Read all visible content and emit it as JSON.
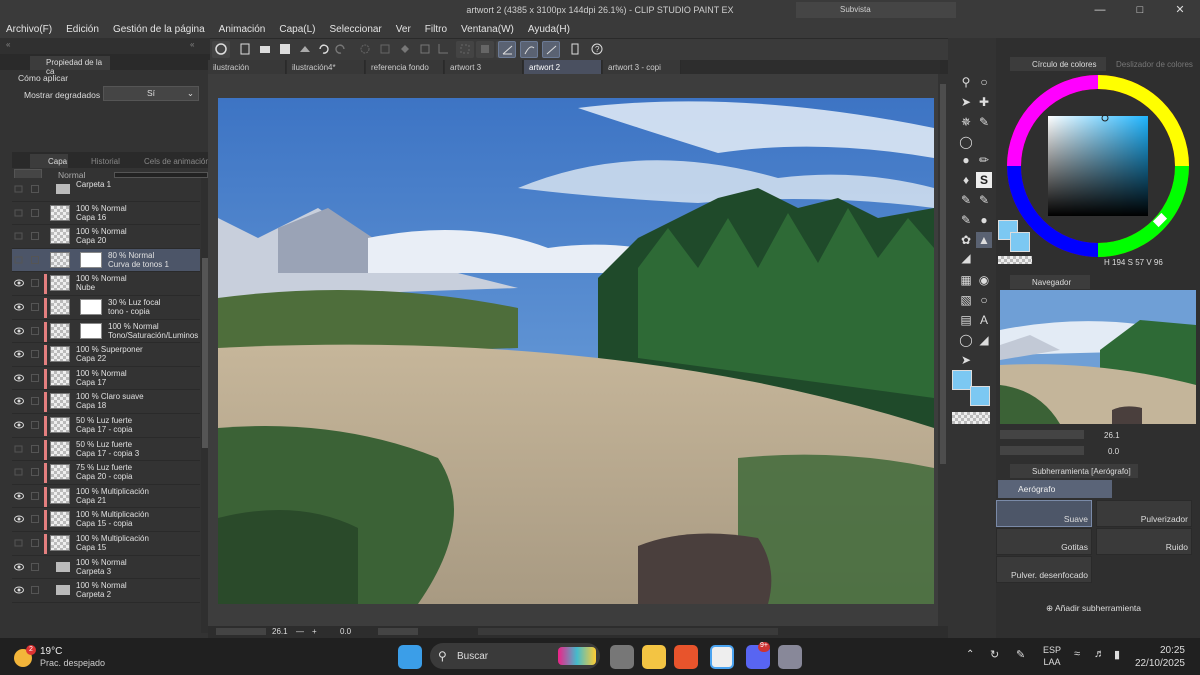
{
  "window": {
    "title": "artwort 2 (4385 x 3100px 144dpi 26.1%)  - CLIP STUDIO PAINT EX",
    "subview_label": "Subvista"
  },
  "menu": [
    "Archivo(F)",
    "Edición",
    "Gestión de la página",
    "Animación",
    "Capa(L)",
    "Seleccionar",
    "Ver",
    "Filtro",
    "Ventana(W)",
    "Ayuda(H)"
  ],
  "left_panel": {
    "property_tab": "Propiedad de la ca",
    "section_title": "Cómo aplicar",
    "gradient_label": "Mostrar degradados",
    "gradient_value": "Sí",
    "tabs": [
      "Capa",
      "Historial",
      "Cels de animación"
    ],
    "blend_mode": "Normal",
    "layers": [
      {
        "l1": "Carpeta 1",
        "l2": "",
        "folder": true,
        "vis": false,
        "sel": false
      },
      {
        "l1": "100 % Normal",
        "l2": "Capa 16",
        "vis": false,
        "sel": false
      },
      {
        "l1": "100 % Normal",
        "l2": "Capa 20",
        "vis": false,
        "sel": false
      },
      {
        "l1": "80 % Normal",
        "l2": "Curva de tonos 1",
        "vis": false,
        "sel": true
      },
      {
        "l1": "100 % Normal",
        "l2": "Nube",
        "vis": true,
        "sel": false
      },
      {
        "l1": "30 % Luz focal",
        "l2": "tono - copia",
        "vis": true,
        "sel": false
      },
      {
        "l1": "100 % Normal",
        "l2": "Tono/Saturación/Luminosida",
        "vis": true,
        "sel": false
      },
      {
        "l1": "100 % Superponer",
        "l2": "Capa 22",
        "vis": true,
        "sel": false
      },
      {
        "l1": "100 % Normal",
        "l2": "Capa 17",
        "vis": true,
        "sel": false
      },
      {
        "l1": "100 % Claro suave",
        "l2": "Capa 18",
        "vis": true,
        "sel": false
      },
      {
        "l1": "50 % Luz fuerte",
        "l2": "Capa 17 - copia",
        "vis": true,
        "sel": false
      },
      {
        "l1": "50 % Luz fuerte",
        "l2": "Capa 17 - copia 3",
        "vis": false,
        "sel": false
      },
      {
        "l1": "75 % Luz fuerte",
        "l2": "Capa 20 - copia",
        "vis": false,
        "sel": false
      },
      {
        "l1": "100 % Multiplicación",
        "l2": "Capa 21",
        "vis": true,
        "sel": false
      },
      {
        "l1": "100 % Multiplicación",
        "l2": "Capa 15 - copia",
        "vis": true,
        "sel": false
      },
      {
        "l1": "100 % Multiplicación",
        "l2": "Capa 15",
        "vis": false,
        "sel": false
      },
      {
        "l1": "100 % Normal",
        "l2": "Carpeta 3",
        "folder": true,
        "vis": true,
        "sel": false
      },
      {
        "l1": "100 % Normal",
        "l2": "Carpeta 2",
        "folder": true,
        "vis": true,
        "sel": false
      }
    ]
  },
  "doc_tabs": [
    "ilustración",
    "ilustración4*",
    "referencia fondo",
    "artwort 3",
    "artwort 2",
    "artwort 3 - copi"
  ],
  "canvas_bar": {
    "zoom": "26.1",
    "angle": "0.0"
  },
  "right_panel": {
    "color_tabs": [
      "Círculo de colores",
      "Deslizador de colores"
    ],
    "hsv": {
      "h": "194",
      "s": "57",
      "v": "96"
    },
    "navigator_label": "Navegador",
    "nav_zoom": "26.1",
    "nav_angle": "0.0",
    "subtool_tab": "Subherramienta [Aerógrafo]",
    "subtool_group": "Aerógrafo",
    "brushes": [
      "Suave",
      "Pulverizador",
      "Gotitas",
      "Ruido",
      "Pulver. desenfocado"
    ],
    "add_subtool": "Añadir subherramienta"
  },
  "taskbar": {
    "temp": "19°C",
    "weather": "Prac. despejado",
    "weather_badge": "2",
    "search": "Buscar",
    "lang1": "ESP",
    "lang2": "LAA",
    "time": "20:25",
    "date": "22/10/2025",
    "notif_badge": "9+"
  },
  "colors": {
    "main": "#7cc8f2",
    "sub": "#7cc8f2",
    "accent": "#4c5568"
  }
}
